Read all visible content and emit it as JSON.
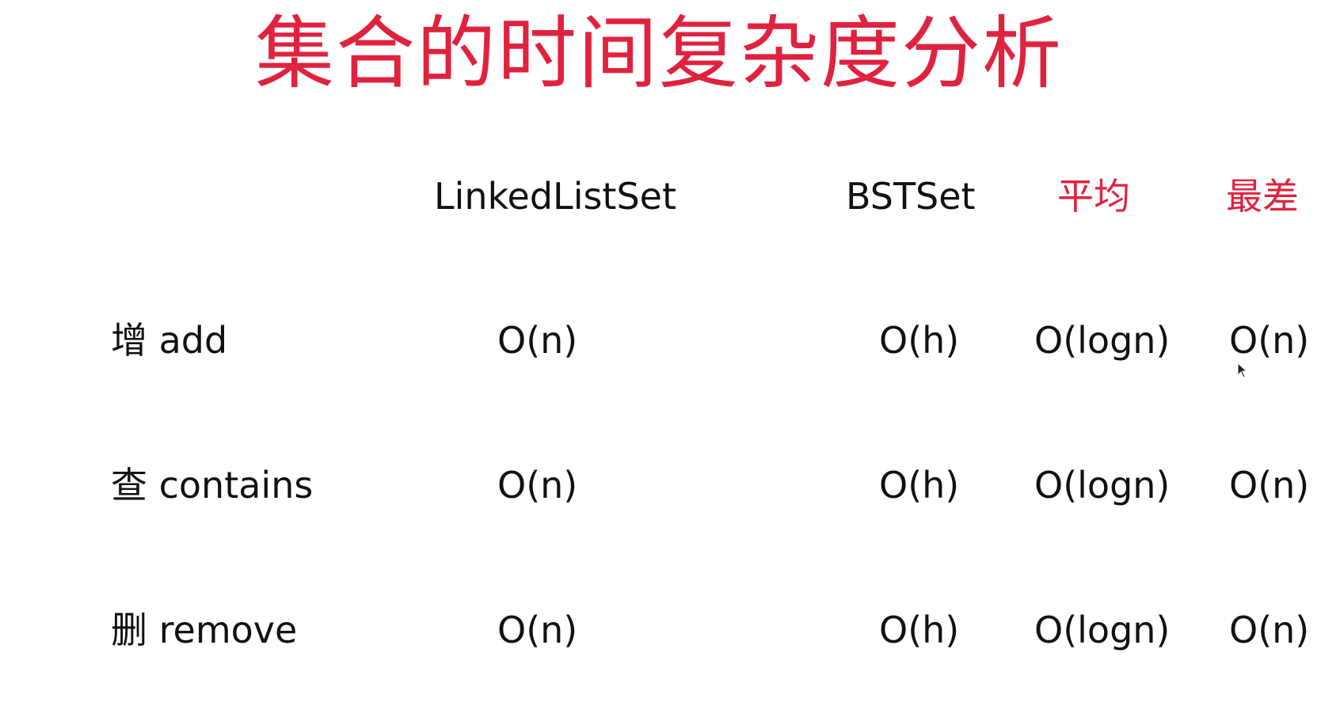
{
  "title": "集合的时间复杂度分析",
  "headers": {
    "linked_list_set": "LinkedListSet",
    "bst_set": "BSTSet",
    "average": "平均",
    "worst": "最差"
  },
  "rows": [
    {
      "label": "增 add",
      "linked_list_set": "O(n)",
      "bst_set": "O(h)",
      "average": "O(logn)",
      "worst": "O(n)"
    },
    {
      "label": "查 contains",
      "linked_list_set": "O(n)",
      "bst_set": "O(h)",
      "average": "O(logn)",
      "worst": "O(n)"
    },
    {
      "label": "删 remove",
      "linked_list_set": "O(n)",
      "bst_set": "O(h)",
      "average": "O(logn)",
      "worst": "O(n)"
    }
  ],
  "colors": {
    "accent": "#e0223f",
    "text": "#111111",
    "background": "#ffffff"
  }
}
